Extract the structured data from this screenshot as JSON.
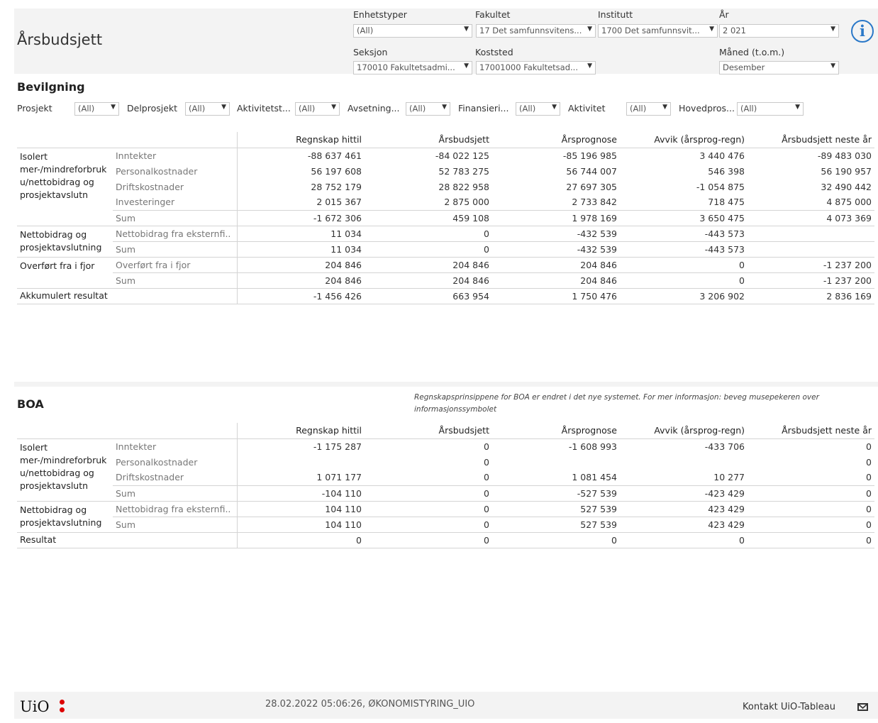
{
  "header": {
    "title": "Årsbudsjett",
    "filters": [
      {
        "label": "Enhetstyper",
        "value": "(All)"
      },
      {
        "label": "Fakultet",
        "value": "17 Det samfunnsvitens..."
      },
      {
        "label": "Institutt",
        "value": "1700 Det samfunnsvit..."
      },
      {
        "label": "År",
        "value": "2 021"
      },
      {
        "label": "Seksjon",
        "value": "170010 Fakultetsadmi..."
      },
      {
        "label": "Koststed",
        "value": "17001000 Fakultetsad..."
      },
      {
        "label": "Måned (t.o.m.)",
        "value": "Desember"
      }
    ]
  },
  "bevilgning": {
    "title": "Bevilgning",
    "filters": [
      {
        "label": "Prosjekt",
        "value": "(All)"
      },
      {
        "label": "Delprosjekt",
        "value": "(All)"
      },
      {
        "label": "Aktivitetst...",
        "value": "(All)"
      },
      {
        "label": "Avsetning...",
        "value": "(All)"
      },
      {
        "label": "Finansieri...",
        "value": "(All)"
      },
      {
        "label": "Aktivitet",
        "value": "(All)"
      },
      {
        "label": "Hovedpros...",
        "value": "(All)"
      }
    ],
    "columns": [
      "Regnskap hittil",
      "Årsbudsjett",
      "Årsprognose",
      "Avvik (årsprog-regn)",
      "Årsbudsjett neste år"
    ],
    "rows": [
      {
        "group": "Isolert mer-/mindreforbruk u/nettobidrag og prosjektavslutn",
        "label": "Inntekter",
        "values": [
          "-88 637 461",
          "-84 022 125",
          "-85 196 985",
          "3 440 476",
          "-89 483 030"
        ]
      },
      {
        "group": "",
        "label": "Personalkostnader",
        "values": [
          "56 197 608",
          "52 783 275",
          "56 744 007",
          "546 398",
          "56 190 957"
        ]
      },
      {
        "group": "",
        "label": "Driftskostnader",
        "values": [
          "28 752 179",
          "28 822 958",
          "27 697 305",
          "-1 054 875",
          "32 490 442"
        ]
      },
      {
        "group": "",
        "label": "Investeringer",
        "values": [
          "2 015 367",
          "2 875 000",
          "2 733 842",
          "718 475",
          "4 875 000"
        ]
      },
      {
        "group": "",
        "label": "Sum",
        "values": [
          "-1 672 306",
          "459 108",
          "1 978 169",
          "3 650 475",
          "4 073 369"
        ]
      },
      {
        "group": "Nettobidrag og prosjektavslutning",
        "label": "Nettobidrag fra eksternfi..",
        "values": [
          "11 034",
          "0",
          "-432 539",
          "-443 573",
          ""
        ]
      },
      {
        "group": "",
        "label": "Sum",
        "values": [
          "11 034",
          "0",
          "-432 539",
          "-443 573",
          ""
        ]
      },
      {
        "group": "Overført fra i fjor",
        "label": "Overført fra i fjor",
        "values": [
          "204 846",
          "204 846",
          "204 846",
          "0",
          "-1 237 200"
        ]
      },
      {
        "group": "",
        "label": "Sum",
        "values": [
          "204 846",
          "204 846",
          "204 846",
          "0",
          "-1 237 200"
        ]
      },
      {
        "group": "Akkumulert resultat",
        "label": "",
        "values": [
          "-1 456 426",
          "663 954",
          "1 750 476",
          "3 206 902",
          "2 836 169"
        ]
      }
    ]
  },
  "boa": {
    "title": "BOA",
    "note": "Regnskapsprinsippene for BOA er endret i det nye systemet. For mer informasjon: beveg musepekeren over informasjonssymbolet",
    "columns": [
      "Regnskap hittil",
      "Årsbudsjett",
      "Årsprognose",
      "Avvik (årsprog-regn)",
      "Årsbudsjett neste år"
    ],
    "rows": [
      {
        "group": "Isolert mer-/mindreforbruk u/nettobidrag og prosjektavslutn",
        "label": "Inntekter",
        "values": [
          "-1 175 287",
          "0",
          "-1 608 993",
          "-433 706",
          "0"
        ]
      },
      {
        "group": "",
        "label": "Personalkostnader",
        "values": [
          "",
          "0",
          "",
          "",
          "0"
        ]
      },
      {
        "group": "",
        "label": "Driftskostnader",
        "values": [
          "1 071 177",
          "0",
          "1 081 454",
          "10 277",
          "0"
        ]
      },
      {
        "group": "",
        "label": "Sum",
        "values": [
          "-104 110",
          "0",
          "-527 539",
          "-423 429",
          "0"
        ]
      },
      {
        "group": "Nettobidrag og prosjektavslutning",
        "label": "Nettobidrag fra eksternfi..",
        "values": [
          "104 110",
          "0",
          "527 539",
          "423 429",
          "0"
        ]
      },
      {
        "group": "",
        "label": "Sum",
        "values": [
          "104 110",
          "0",
          "527 539",
          "423 429",
          "0"
        ]
      },
      {
        "group": "Resultat",
        "label": "",
        "values": [
          "0",
          "0",
          "0",
          "0",
          "0"
        ]
      }
    ]
  },
  "footer": {
    "logo_text": "UiO",
    "timestamp": "28.02.2022 05:06:26, ØKONOMISTYRING_UIO",
    "contact": "Kontakt UiO-Tableau"
  }
}
